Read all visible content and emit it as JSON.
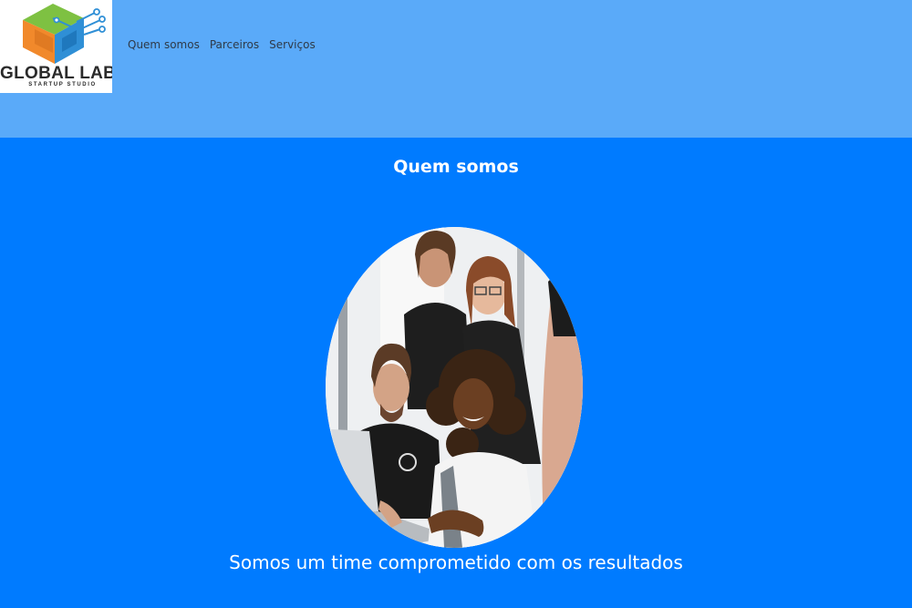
{
  "header": {
    "logo": {
      "title": "GLOBAL LABS",
      "subtitle": "STARTUP STUDIO",
      "icon": "cube-circuit-logo"
    },
    "nav": [
      {
        "label": "Quem somos"
      },
      {
        "label": "Parceiros"
      },
      {
        "label": "Serviços"
      }
    ]
  },
  "main": {
    "section_title": "Quem somos",
    "photo_icon": "team-photo",
    "tagline": "Somos um time comprometido com os resultados"
  },
  "colors": {
    "header_bg": "#5aaaf9",
    "page_bg": "#007bff",
    "text_light": "#ffffff",
    "nav_text": "#2f3a48"
  }
}
